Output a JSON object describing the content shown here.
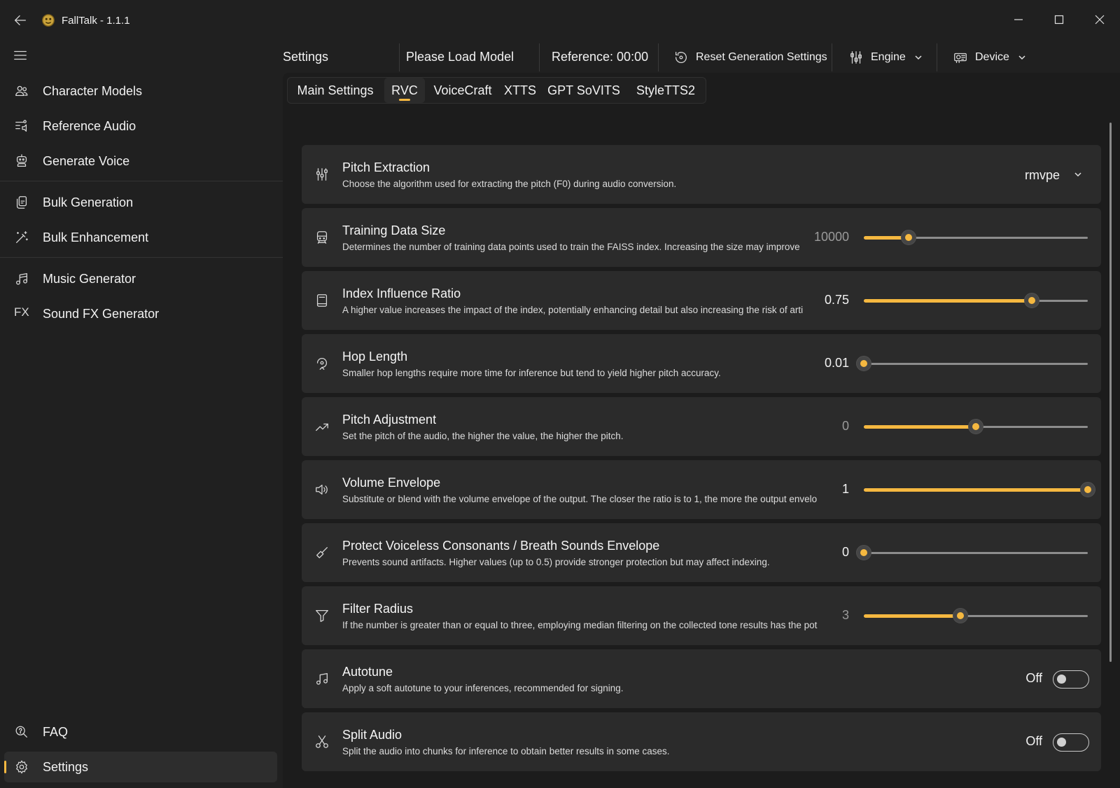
{
  "app": {
    "title": "FallTalk - 1.1.1"
  },
  "sidebar": {
    "items": [
      {
        "label": "Character Models",
        "icon": "people-icon"
      },
      {
        "label": "Reference Audio",
        "icon": "reference-audio-icon"
      },
      {
        "label": "Generate Voice",
        "icon": "robot-icon"
      },
      {
        "label": "Bulk Generation",
        "icon": "copy-stack-icon"
      },
      {
        "label": "Bulk Enhancement",
        "icon": "magic-wand-icon"
      },
      {
        "label": "Music Generator",
        "icon": "music-note-icon"
      },
      {
        "label": "Sound FX Generator",
        "icon": "fx-icon",
        "icon_text": "FX"
      }
    ],
    "footer": [
      {
        "label": "FAQ",
        "icon": "help-search-icon"
      },
      {
        "label": "Settings",
        "icon": "gear-icon",
        "active": true
      }
    ]
  },
  "commandbar": {
    "page_title": "Settings",
    "model_status": "Please Load Model",
    "reference": "Reference: 00:00",
    "reset_label": "Reset Generation Settings",
    "engine_label": "Engine",
    "device_label": "Device"
  },
  "tabs": [
    "Main Settings",
    "RVC",
    "VoiceCraft",
    "XTTS",
    "GPT SoVITS",
    "StyleTTS2"
  ],
  "selected_tab": "RVC",
  "settings": [
    {
      "title": "Pitch Extraction",
      "desc": "Choose the algorithm used for extracting the pitch (F0) during audio conversion.",
      "control": "dropdown",
      "value": "rmvpe",
      "icon": "pitch-extraction-icon"
    },
    {
      "title": "Training Data Size",
      "desc": "Determines the number of training data points used to train the FAISS index. Increasing the size may improve",
      "control": "slider",
      "value": "10000",
      "fraction": 0.2,
      "dim": true,
      "icon": "train-icon"
    },
    {
      "title": "Index Influence Ratio",
      "desc": "A higher value increases the impact of the index, potentially enhancing detail but also increasing the risk of arti",
      "control": "slider",
      "value": "0.75",
      "fraction": 0.75,
      "dim": false,
      "icon": "book-icon"
    },
    {
      "title": "Hop Length",
      "desc": "Smaller hop lengths require more time for inference but tend to yield higher pitch accuracy.",
      "control": "slider",
      "value": "0.01",
      "fraction": 0.0,
      "dim": false,
      "icon": "hop-icon"
    },
    {
      "title": "Pitch Adjustment",
      "desc": "Set the pitch of the audio, the higher the value, the higher the pitch.",
      "control": "slider",
      "value": "0",
      "fraction": 0.5,
      "dim": true,
      "icon": "trend-up-icon"
    },
    {
      "title": "Volume Envelope",
      "desc": "Substitute or blend with the volume envelope of the output. The closer the ratio is to 1, the more the output envelo",
      "control": "slider",
      "value": "1",
      "fraction": 1.0,
      "dim": false,
      "icon": "speaker-icon"
    },
    {
      "title": "Protect Voiceless Consonants / Breath Sounds Envelope",
      "desc": "Prevents sound artifacts. Higher values (up to 0.5) provide stronger protection but may affect indexing.",
      "control": "slider",
      "value": "0",
      "fraction": 0.0,
      "dim": false,
      "icon": "brush-icon"
    },
    {
      "title": "Filter Radius",
      "desc": "If the number is greater than or equal to three, employing median filtering on the collected tone results has the pot",
      "control": "slider",
      "value": "3",
      "fraction": 0.43,
      "dim": true,
      "icon": "filter-icon"
    },
    {
      "title": "Autotune",
      "desc": "Apply a soft autotune to your inferences, recommended for signing.",
      "control": "toggle",
      "value": "Off",
      "icon": "music-note-icon"
    },
    {
      "title": "Split Audio",
      "desc": "Split the audio into chunks for inference to obtain better results in some cases.",
      "control": "toggle",
      "value": "Off",
      "icon": "scissors-icon"
    }
  ],
  "colors": {
    "accent": "#f5b840",
    "background": "#202020",
    "card": "#2b2b2b"
  }
}
